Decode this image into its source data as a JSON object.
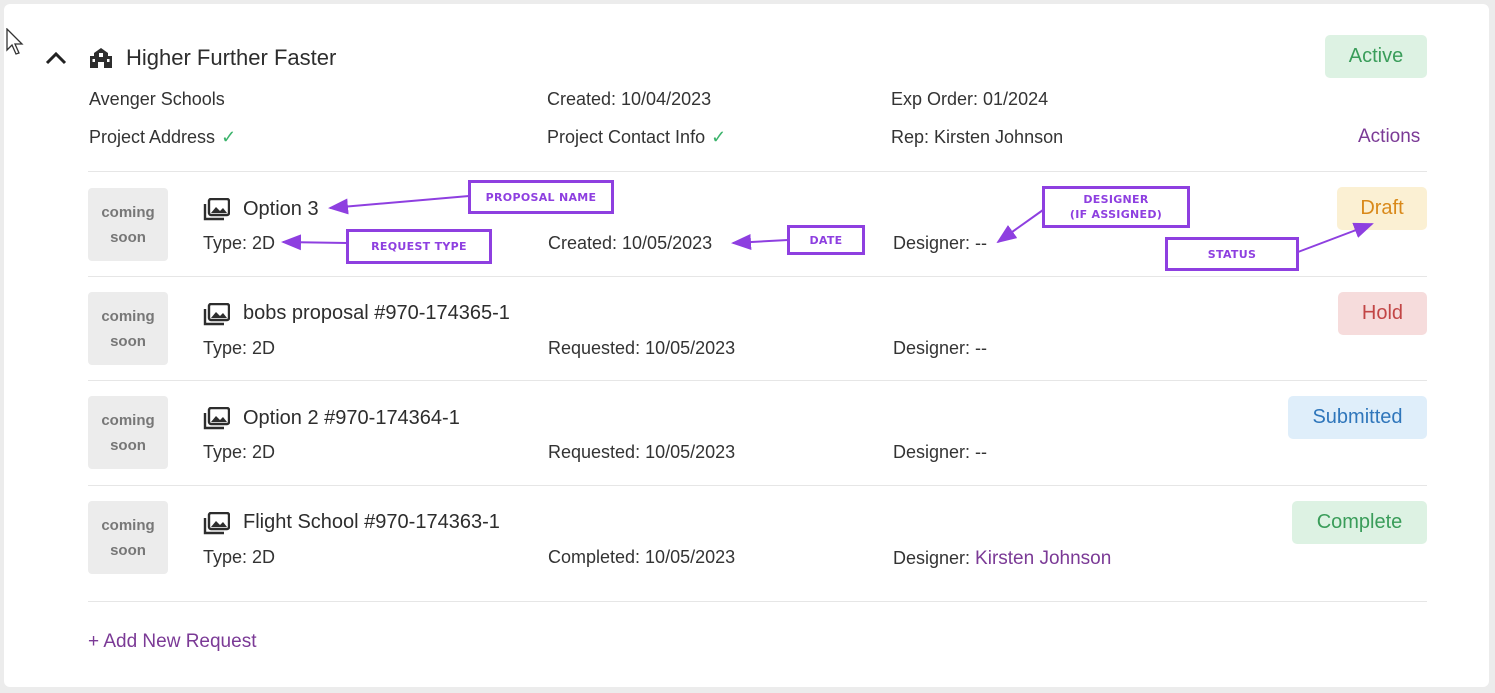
{
  "project": {
    "title": "Higher Further Faster",
    "status": "Active",
    "organization": "Avenger Schools",
    "created": "Created: 10/04/2023",
    "exp_order": "Exp Order: 01/2024",
    "address_label": "Project Address",
    "contact_label": "Project Contact Info",
    "rep": "Rep: Kirsten Johnson",
    "actions_label": "Actions"
  },
  "requests": [
    {
      "thumb_line1": "coming",
      "thumb_line2": "soon",
      "name": "Option 3",
      "type": "Type: 2D",
      "date": "Created: 10/05/2023",
      "designer_label": "Designer: --",
      "designer_name": "",
      "status": "Draft"
    },
    {
      "thumb_line1": "coming",
      "thumb_line2": "soon",
      "name": "bobs proposal #970-174365-1",
      "type": "Type: 2D",
      "date": "Requested: 10/05/2023",
      "designer_label": "Designer: --",
      "designer_name": "",
      "status": "Hold"
    },
    {
      "thumb_line1": "coming",
      "thumb_line2": "soon",
      "name": "Option 2 #970-174364-1",
      "type": "Type: 2D",
      "date": "Requested: 10/05/2023",
      "designer_label": "Designer: --",
      "designer_name": "",
      "status": "Submitted"
    },
    {
      "thumb_line1": "coming",
      "thumb_line2": "soon",
      "name": "Flight School #970-174363-1",
      "type": "Type: 2D",
      "date": "Completed: 10/05/2023",
      "designer_label": "Designer: ",
      "designer_name": "Kirsten Johnson",
      "status": "Complete"
    }
  ],
  "add_request_label": "+ Add New Request",
  "annotations": {
    "proposal_name": "PROPOSAL NAME",
    "request_type": "REQUEST TYPE",
    "date": "DATE",
    "designer_line1": "DESIGNER",
    "designer_line2": "(IF ASSIGNED)",
    "status": "STATUS"
  },
  "icons": [
    "cursor-icon",
    "chevron-up-icon",
    "school-building-icon",
    "checkmark-icon",
    "image-gallery-icon"
  ],
  "colors": {
    "accent_purple": "#7b3a96",
    "annotation_purple": "#8e3fe0",
    "check_green": "#3bb36b"
  }
}
